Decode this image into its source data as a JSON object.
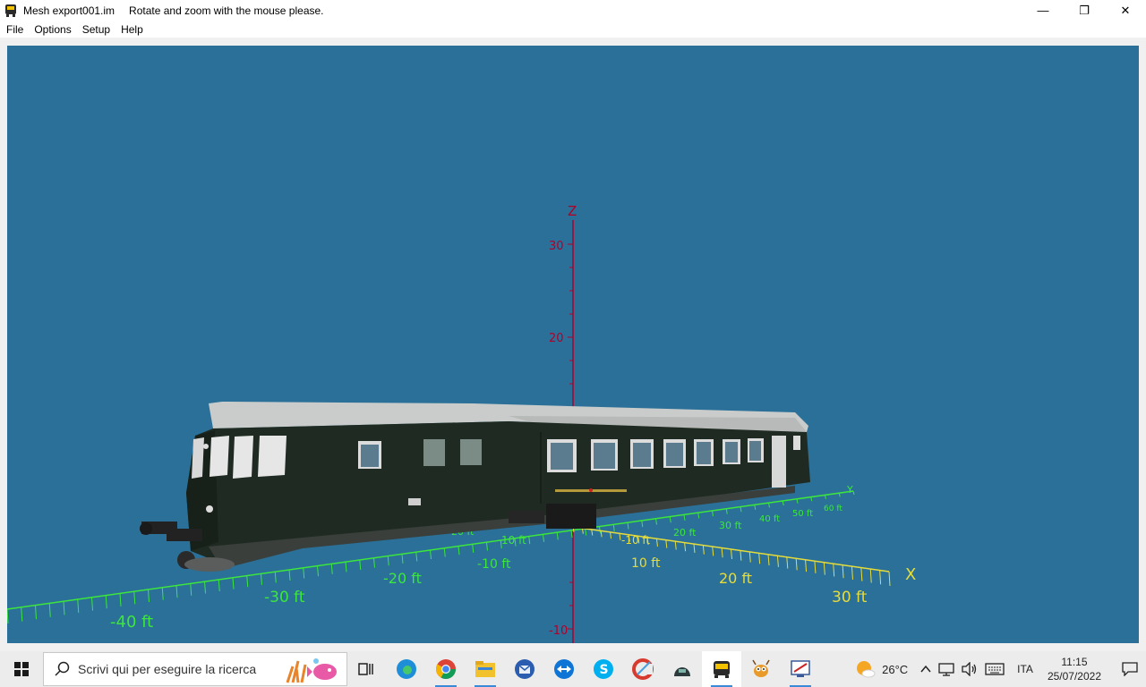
{
  "window": {
    "title": "Mesh export001.im",
    "message": "Rotate and zoom with the mouse please.",
    "minimize_glyph": "—",
    "restore_glyph": "❐",
    "close_glyph": "✕"
  },
  "menu": [
    "File",
    "Options",
    "Setup",
    "Help"
  ],
  "viewport": {
    "background": "#2b7098",
    "axis_z_label": "Z",
    "axis_x_label": "X",
    "axis_y_label": "Y",
    "z_ticks": [
      "30",
      "20",
      "-10"
    ],
    "x_ticks": [
      "-40 ft",
      "-30 ft",
      "-20 ft",
      "-10 ft",
      "10 ft",
      "20 ft",
      "30 ft"
    ],
    "y_ticks": [
      "-20 ft",
      "-10 ft",
      "10 ft",
      "20 ft",
      "30 ft",
      "40 ft",
      "50 ft",
      "60 ft"
    ],
    "colors": {
      "z_axis": "#b0002a",
      "x_axis": "#e6dc3c",
      "y_axis": "#3ce63c",
      "train": "#1f2b22"
    }
  },
  "taskbar": {
    "search_placeholder": "Scrivi qui per eseguire la ricerca",
    "apps": [
      "task-view",
      "edge",
      "chrome",
      "file-explorer",
      "thunderbird",
      "teamviewer",
      "skype",
      "ccleaner",
      "vpn",
      "train-sim",
      "bug-app",
      "screen-tool"
    ],
    "weather": "26°C",
    "language": "ITA",
    "time": "11:15",
    "date": "25/07/2022"
  }
}
